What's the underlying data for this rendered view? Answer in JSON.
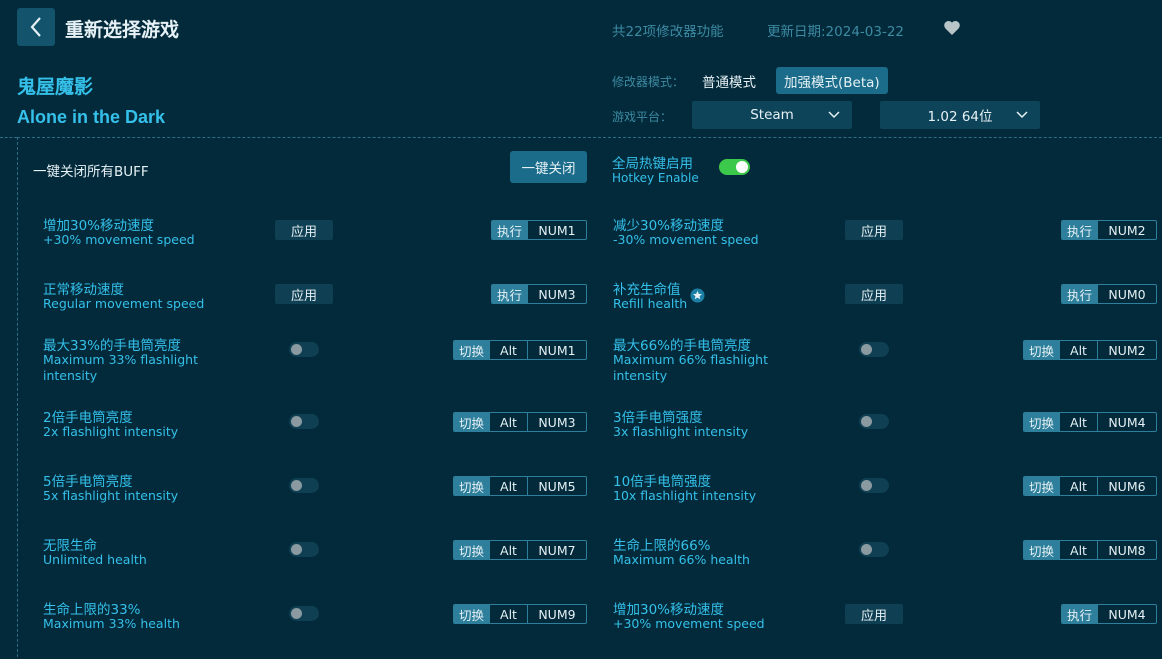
{
  "header": {
    "back_label": "‹",
    "title": "重新选择游戏",
    "feature_count": "共22项修改器功能",
    "update_date": "更新日期:2024-03-22"
  },
  "game": {
    "title_cn": "鬼屋魔影",
    "title_en": "Alone in the Dark"
  },
  "mode": {
    "label": "修改器模式：",
    "normal": "普通模式",
    "beta": "加强模式(Beta)",
    "selected": "beta"
  },
  "platform": {
    "label": "游戏平台：",
    "value": "Steam",
    "version": "1.02 64位"
  },
  "panel": {
    "close_all_label": "一键关闭所有BUFF",
    "close_all_button": "一键关闭",
    "hotkey_label": "全局热键启用",
    "hotkey_sub": "Hotkey Enable",
    "hotkey_enabled": true
  },
  "labels": {
    "apply": "应用",
    "execute": "执行",
    "toggle": "切换",
    "alt": "Alt"
  },
  "features": [
    {
      "cn": "增加30%移动速度",
      "en": "+30% movement speed",
      "type": "apply",
      "key": "NUM1"
    },
    {
      "cn": "减少30%移动速度",
      "en": "-30% movement speed",
      "type": "apply",
      "key": "NUM2"
    },
    {
      "cn": "正常移动速度",
      "en": "Regular movement speed",
      "type": "apply",
      "key": "NUM3"
    },
    {
      "cn": "补充生命值",
      "en": "Refill health",
      "type": "apply",
      "key": "NUM0",
      "star": true
    },
    {
      "cn": "最大33%的手电筒亮度",
      "en": "Maximum 33% flashlight intensity",
      "type": "toggle",
      "key": "NUM1"
    },
    {
      "cn": "最大66%的手电筒亮度",
      "en": "Maximum 66% flashlight intensity",
      "type": "toggle",
      "key": "NUM2"
    },
    {
      "cn": "2倍手电筒亮度",
      "en": "2x flashlight intensity",
      "type": "toggle",
      "key": "NUM3"
    },
    {
      "cn": "3倍手电筒强度",
      "en": "3x flashlight intensity",
      "type": "toggle",
      "key": "NUM4"
    },
    {
      "cn": "5倍手电筒亮度",
      "en": "5x flashlight intensity",
      "type": "toggle",
      "key": "NUM5"
    },
    {
      "cn": "10倍手电筒强度",
      "en": "10x flashlight intensity",
      "type": "toggle",
      "key": "NUM6"
    },
    {
      "cn": "无限生命",
      "en": "Unlimited health",
      "type": "toggle",
      "key": "NUM7"
    },
    {
      "cn": "生命上限的66%",
      "en": "Maximum 66% health",
      "type": "toggle",
      "key": "NUM8"
    },
    {
      "cn": "生命上限的33%",
      "en": "Maximum 33% health",
      "type": "toggle",
      "key": "NUM9"
    },
    {
      "cn": "增加30%移动速度",
      "en": "+30% movement speed",
      "type": "apply",
      "key": "NUM4"
    }
  ],
  "colors": {
    "background": "#022a3a",
    "accent": "#35c0ea",
    "button": "#1b6c8a",
    "toggle_on": "#3cc84a"
  },
  "icons": {
    "back": "chevron-left-icon",
    "favorite": "heart-icon",
    "dropdown": "chevron-down-icon",
    "star": "star-badge-icon"
  }
}
